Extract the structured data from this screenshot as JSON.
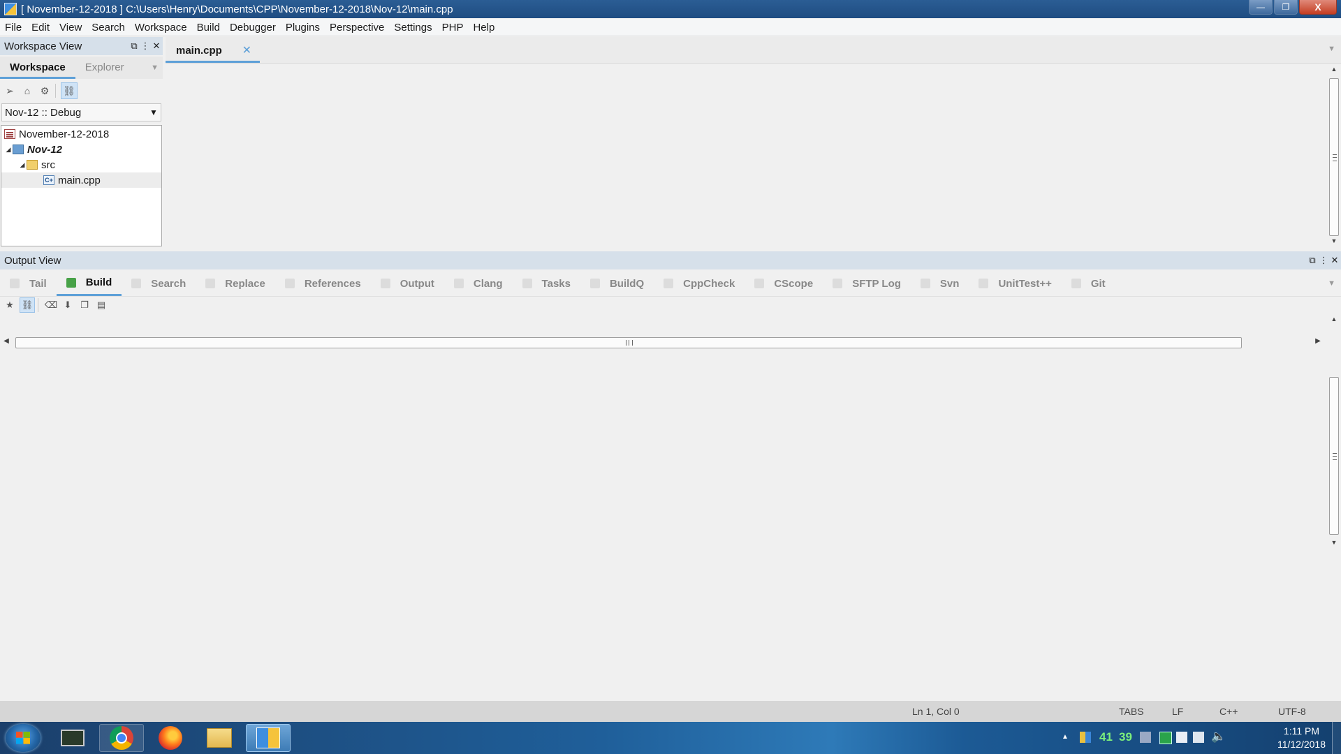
{
  "window": {
    "title": "[ November-12-2018 ] C:\\Users\\Henry\\Documents\\CPP\\November-12-2018\\Nov-12\\main.cpp",
    "minimize": "—",
    "maximize": "❐",
    "close": "X"
  },
  "menubar": {
    "items": [
      "File",
      "Edit",
      "View",
      "Search",
      "Workspace",
      "Build",
      "Debugger",
      "Plugins",
      "Perspective",
      "Settings",
      "PHP",
      "Help"
    ]
  },
  "workspace_pane": {
    "title": "Workspace View",
    "tabs": [
      "Workspace",
      "Explorer"
    ],
    "active_tab": "Workspace",
    "toolbar_icons": [
      "send-icon",
      "home-icon",
      "gear-icon",
      "link-icon"
    ],
    "config_combo": "Nov-12 :: Debug",
    "tree": [
      {
        "label": "November-12-2018",
        "kind": "workspace",
        "depth": 0
      },
      {
        "label": "Nov-12",
        "kind": "project",
        "depth": 0,
        "expanded": true,
        "bold_italic": true
      },
      {
        "label": "src",
        "kind": "folder",
        "depth": 1,
        "expanded": true
      },
      {
        "label": "main.cpp",
        "kind": "cpp-file",
        "depth": 2,
        "selected": true
      }
    ]
  },
  "editor": {
    "tabs": [
      {
        "label": "main.cpp",
        "active": true,
        "close": "✕"
      }
    ]
  },
  "output_pane": {
    "title": "Output View",
    "tabs": [
      "Tail",
      "Build",
      "Search",
      "Replace",
      "References",
      "Output",
      "Clang",
      "Tasks",
      "BuildQ",
      "CppCheck",
      "CScope",
      "SFTP Log",
      "Svn",
      "UnitTest++",
      "Git"
    ],
    "active_tab": "Build",
    "toolbar_icons": [
      "pin-icon",
      "link-icon",
      "clear-icon",
      "save-icon",
      "copy-icon",
      "paste-icon"
    ]
  },
  "statusbar": {
    "position": "Ln 1, Col 0",
    "indent": "TABS",
    "eol": "LF",
    "language": "C++",
    "encoding": "UTF-8"
  },
  "taskbar": {
    "apps": [
      "computer-icon",
      "chrome-icon",
      "firefox-icon",
      "file-explorer-icon",
      "codelite-icon"
    ],
    "active_app": "codelite-icon",
    "tray_num1": "41",
    "tray_num2": "39",
    "time": "1:11 PM",
    "date": "11/12/2018",
    "show_hidden": "▲"
  }
}
